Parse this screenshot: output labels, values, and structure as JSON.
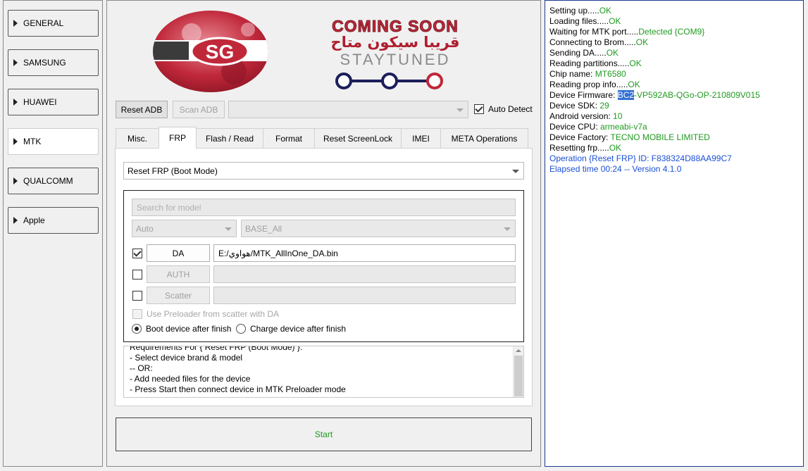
{
  "sidebar": {
    "items": [
      {
        "label": "GENERAL"
      },
      {
        "label": "SAMSUNG"
      },
      {
        "label": "HUAWEI"
      },
      {
        "label": "MTK"
      },
      {
        "label": "QUALCOMM"
      },
      {
        "label": "Apple"
      }
    ],
    "active": "MTK"
  },
  "banner": {
    "logo_text": "SG",
    "headline": "COMING SOON",
    "arabic": "قريبا سيكون متاح",
    "tagline": "STAYTUNED"
  },
  "adb": {
    "reset_label": "Reset ADB",
    "scan_label": "Scan ADB",
    "port_value": "",
    "auto_detect_label": "Auto Detect",
    "auto_detect_checked": true
  },
  "tabs": [
    {
      "label": "Misc."
    },
    {
      "label": "FRP"
    },
    {
      "label": "Flash / Read"
    },
    {
      "label": "Format"
    },
    {
      "label": "Reset ScreenLock"
    },
    {
      "label": "IMEI"
    },
    {
      "label": "META Operations"
    }
  ],
  "active_tab": "FRP",
  "frp": {
    "operation_value": "Reset FRP (Boot Mode)",
    "search_placeholder": "Search for model",
    "mode_value": "Auto",
    "base_value": "BASE_All",
    "da_label": "DA",
    "da_checked": true,
    "da_path": "E:/هواوي/MTK_AllInOne_DA.bin",
    "auth_label": "AUTH",
    "auth_checked": false,
    "auth_path": "",
    "scatter_label": "Scatter",
    "scatter_checked": false,
    "scatter_path": "",
    "use_preloader_label": "Use Preloader from scatter with DA",
    "boot_after_label": "Boot device after finish",
    "charge_after_label": "Charge device after finish",
    "after_finish_selected": "boot"
  },
  "requirements": {
    "lines": [
      "Requirements For { Reset FRP (Boot Mode) }:",
      "- Select device brand & model",
      "-- OR:",
      "- Add needed files for the device",
      "- Press Start then connect device in MTK Preloader mode"
    ]
  },
  "start_label": "Start",
  "log": {
    "lines": [
      {
        "label": "Setting up.....",
        "value": "OK",
        "color": "#1f9a1f"
      },
      {
        "label": "Loading files.....",
        "value": "OK",
        "color": "#1f9a1f"
      },
      {
        "label": "Waiting for MTK port.....",
        "value": "Detected {COM9}",
        "color": "#1f9a1f"
      },
      {
        "label": "Connecting to Brom.....",
        "value": "OK",
        "color": "#1f9a1f"
      },
      {
        "label": "Sending DA.....",
        "value": "OK",
        "color": "#1f9a1f"
      },
      {
        "label": "Reading partitions.....",
        "value": "OK",
        "color": "#1f9a1f"
      },
      {
        "label": "Chip name: ",
        "value": "MT6580",
        "color": "#1f9a1f"
      },
      {
        "label": "Reading prop info.....",
        "value": "OK",
        "color": "#1f9a1f"
      },
      {
        "label": "Device Firmware: ",
        "selected": "BC2",
        "value": "-VP592AB-QGo-OP-210809V015",
        "color": "#1f9a1f"
      },
      {
        "label": "Device SDK: ",
        "value": "29",
        "color": "#1f9a1f"
      },
      {
        "label": "Android version: ",
        "value": "10",
        "color": "#1f9a1f"
      },
      {
        "label": "Device CPU: ",
        "value": "armeabi-v7a",
        "color": "#1f9a1f"
      },
      {
        "label": "Device Factory: ",
        "value": "TECNO MOBILE LIMITED",
        "color": "#1f9a1f"
      },
      {
        "label": "Resetting frp.....",
        "value": "OK",
        "color": "#1f9a1f"
      },
      {
        "label": "Operation {Reset FRP} ID: F838324D88AA99C7",
        "value": "",
        "color": "#1a4fd6",
        "whole_line_color": true
      },
      {
        "label": "Elapsed time 00:24 -- Version 4.1.0",
        "value": "",
        "color": "#1a4fd6",
        "whole_line_color": true
      }
    ]
  },
  "colors": {
    "ok_green": "#1f9a1f",
    "info_blue": "#1a4fd6",
    "selection": "#3470d4",
    "banner_red": "#c0283a",
    "banner_navy": "#1c1f5a"
  }
}
